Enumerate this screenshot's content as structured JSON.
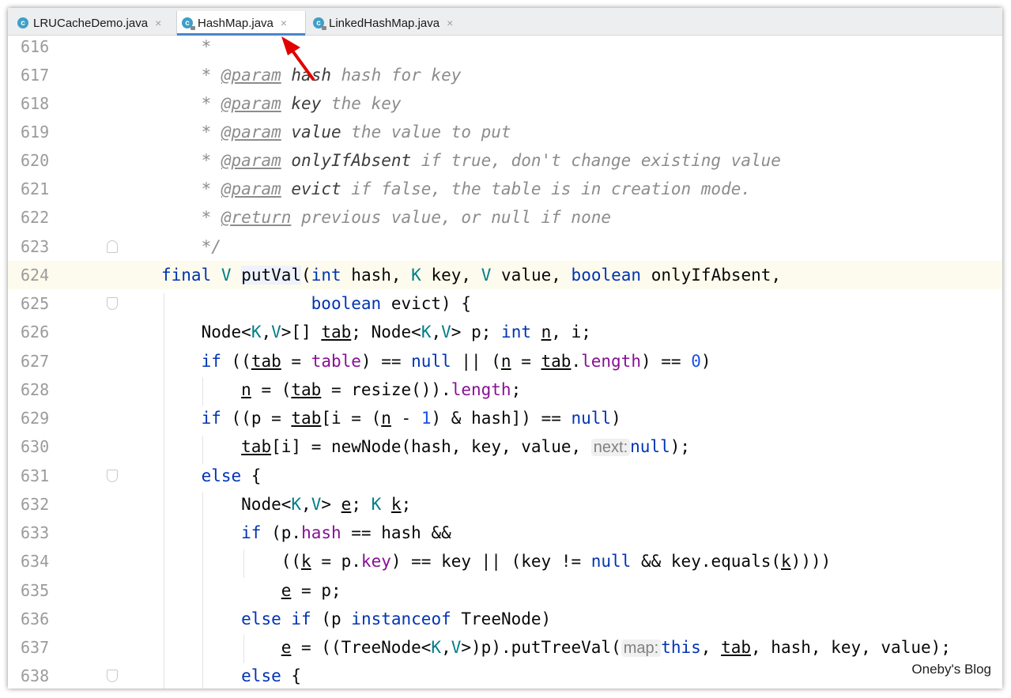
{
  "tabs": [
    {
      "label": "LRUCacheDemo.java",
      "icon": "class-icon",
      "close": "×"
    },
    {
      "label": "HashMap.java",
      "icon": "class-locked-icon",
      "close": "×"
    },
    {
      "label": "LinkedHashMap.java",
      "icon": "class-locked-icon",
      "close": "×"
    }
  ],
  "tab_icon_letter": "c",
  "colors": {
    "keyword": "#0033b3",
    "generic": "#007e8a",
    "field": "#871094",
    "number": "#1750eb",
    "comment": "#8c8c8c",
    "arrow": "#e00000",
    "tab_underline": "#4a86c8"
  },
  "lines": [
    {
      "n": "616",
      "doc_star": "*"
    },
    {
      "n": "617",
      "star": "*",
      "tag": "@param",
      "name": "hash",
      "desc": "hash for key"
    },
    {
      "n": "618",
      "star": "*",
      "tag": "@param",
      "name": "key",
      "desc": "the key"
    },
    {
      "n": "619",
      "star": "*",
      "tag": "@param",
      "name": "value",
      "desc": "the value to put"
    },
    {
      "n": "620",
      "star": "*",
      "tag": "@param",
      "name": "onlyIfAbsent",
      "desc": "if true, don't change existing value"
    },
    {
      "n": "621",
      "star": "*",
      "tag": "@param",
      "name": "evict",
      "desc": "if false, the table is in creation mode."
    },
    {
      "n": "622",
      "star": "*",
      "tag": "@return",
      "name": "",
      "desc": "previous value, or null if none"
    },
    {
      "n": "623",
      "doc_end": "*/"
    },
    {
      "n": "624"
    },
    {
      "n": "625"
    },
    {
      "n": "626"
    },
    {
      "n": "627"
    },
    {
      "n": "628"
    },
    {
      "n": "629"
    },
    {
      "n": "630"
    },
    {
      "n": "631"
    },
    {
      "n": "632"
    },
    {
      "n": "633"
    },
    {
      "n": "634"
    },
    {
      "n": "635"
    },
    {
      "n": "636"
    },
    {
      "n": "637"
    },
    {
      "n": "638"
    }
  ],
  "tk": {
    "final": "final",
    "V": "V",
    "K": "K",
    "putVal": "putVal",
    "int": "int",
    "boolean": "boolean",
    "hash": "hash",
    "key": "key",
    "value": "value",
    "onlyIfAbsent": "onlyIfAbsent",
    "evict": "evict",
    "Node": "Node",
    "tab": "tab",
    "p": "p",
    "n": "n",
    "i": "i",
    "if": "if",
    "else": "else",
    "table": "table",
    "null": "null",
    "length": "length",
    "zero": "0",
    "one": "1",
    "resize": "resize",
    "newNode": "newNode",
    "e": "e",
    "k": "k",
    "equals": "equals",
    "instanceof": "instanceof",
    "TreeNode": "TreeNode",
    "putTreeVal": "putTreeVal",
    "this": "this"
  },
  "hints": {
    "next": "next:",
    "map": "map:"
  },
  "watermark": "Oneby's Blog"
}
